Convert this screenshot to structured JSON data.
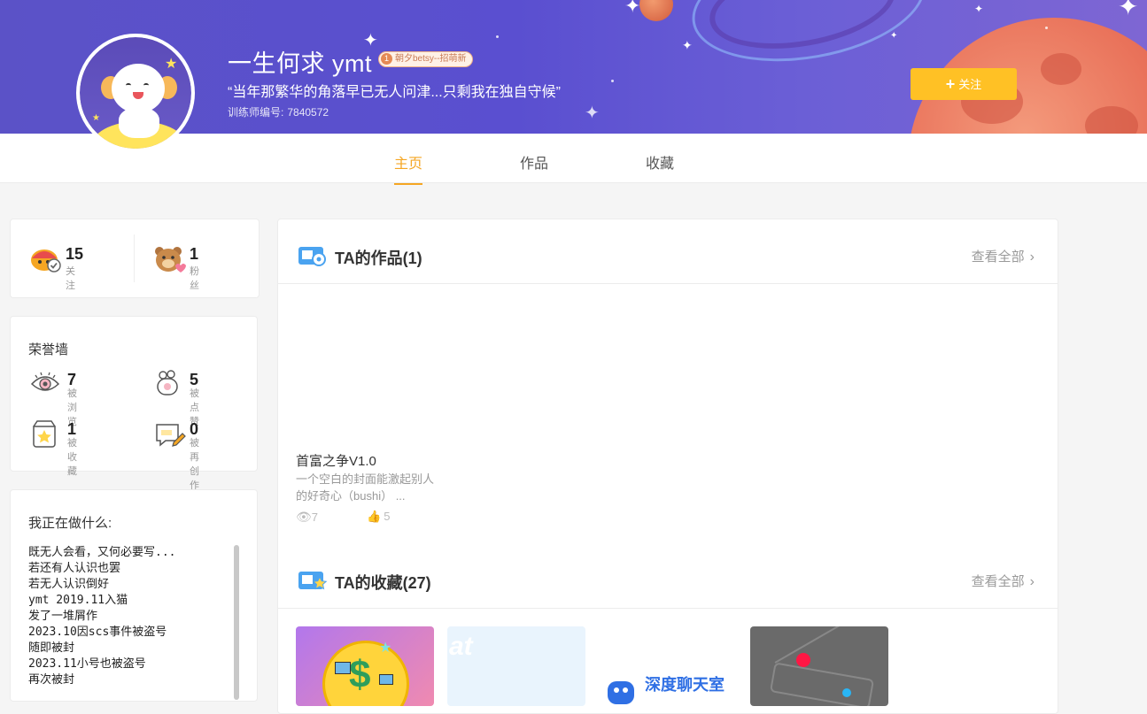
{
  "header": {
    "username": "一生何求 ymt",
    "badge_level": "1",
    "badge_text": "朝夕betsy--招萌新",
    "motto": "“当年那繁华的角落早已无人问津...只剩我在独自守候”",
    "trainer_label": "训练师编号:",
    "trainer_id": "7840572",
    "follow_button": "关注"
  },
  "tabs": [
    {
      "label": "主页",
      "active": true
    },
    {
      "label": "作品",
      "active": false
    },
    {
      "label": "收藏",
      "active": false
    }
  ],
  "social": {
    "following_count": "15",
    "following_label": "关注",
    "fans_count": "1",
    "fans_label": "粉丝"
  },
  "honor": {
    "title": "荣誉墙",
    "views_count": "7",
    "views_label": "被浏览",
    "likes_count": "5",
    "likes_label": "被点赞",
    "favorites_count": "1",
    "favorites_label": "被收藏",
    "remix_count": "0",
    "remix_label": "被再创作"
  },
  "doing": {
    "title": "我正在做什么:",
    "lines": [
      "既无人会看，又何必要写...",
      "若还有人认识也罢",
      "若无人认识倒好",
      "ymt 2019.11入猫",
      "发了一堆屑作",
      "2023.10因scs事件被盗号",
      "随即被封",
      "2023.11小号也被盗号",
      "再次被封"
    ]
  },
  "works": {
    "title": "TA的作品(1)",
    "view_all": "查看全部",
    "item": {
      "title": "首富之争V1.0",
      "desc": "一个空白的封面能激起别人的好奇心（bushi）  ...",
      "views": "7",
      "likes": "5"
    }
  },
  "favorites": {
    "title": "TA的收藏(27)",
    "view_all": "查看全部",
    "thumb_texts": [
      "at",
      "深度聊天室"
    ]
  },
  "colors": {
    "accent": "#f5a623",
    "follow_button": "#ffc125",
    "banner": "#5b52c7"
  }
}
